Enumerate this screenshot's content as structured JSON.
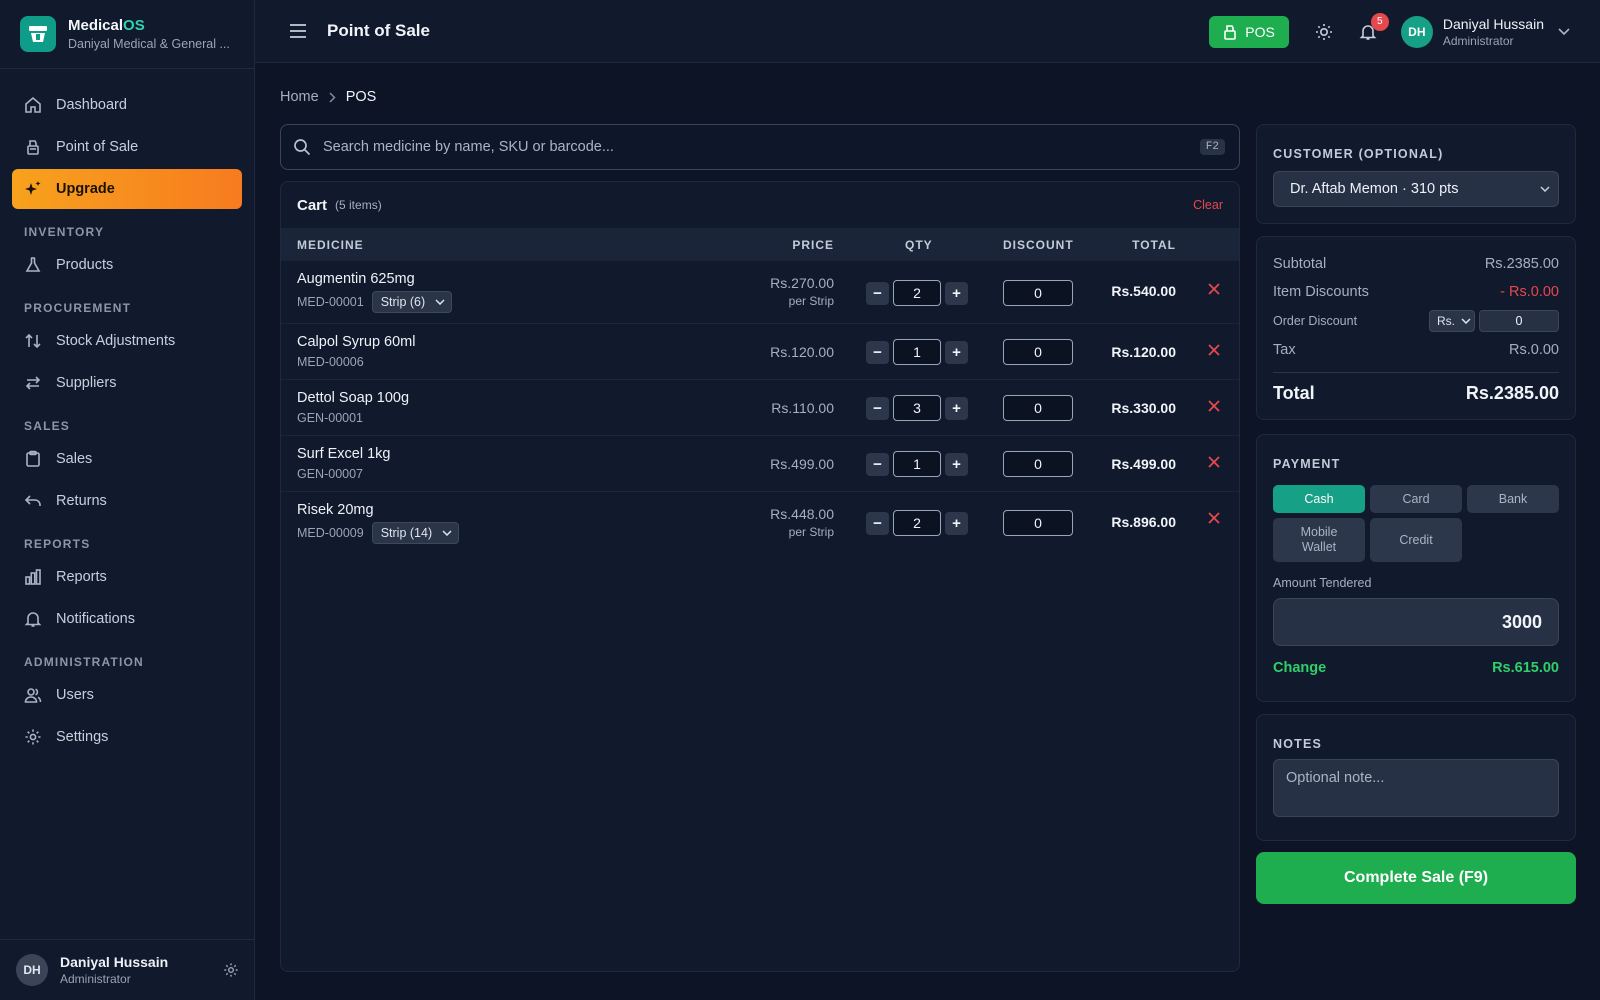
{
  "brand": {
    "name_main": "Medical",
    "name_accent": "OS",
    "subtitle": "Daniyal Medical & General ..."
  },
  "sidebar": {
    "dashboard": "Dashboard",
    "point_of_sale": "Point of Sale",
    "upgrade": "Upgrade",
    "section_inventory": "INVENTORY",
    "products": "Products",
    "section_procurement": "PROCUREMENT",
    "stock_adjustments": "Stock Adjustments",
    "suppliers": "Suppliers",
    "section_sales": "SALES",
    "sales": "Sales",
    "returns": "Returns",
    "section_reports": "REPORTS",
    "reports": "Reports",
    "notifications": "Notifications",
    "section_administration": "ADMINISTRATION",
    "users": "Users",
    "settings": "Settings"
  },
  "sidebar_user": {
    "initials": "DH",
    "name": "Daniyal Hussain",
    "role": "Administrator"
  },
  "topbar": {
    "title": "Point of Sale",
    "pos_label": "POS",
    "notification_count": "5",
    "user_initials": "DH",
    "user_name": "Daniyal Hussain",
    "user_role": "Administrator"
  },
  "breadcrumb": {
    "home": "Home",
    "current": "POS"
  },
  "search": {
    "placeholder": "Search medicine by name, SKU or barcode...",
    "shortcut": "F2"
  },
  "cart": {
    "title": "Cart",
    "count": "(5 items)",
    "clear": "Clear",
    "columns": {
      "medicine": "MEDICINE",
      "price": "PRICE",
      "qty": "QTY",
      "discount": "DISCOUNT",
      "total": "TOTAL"
    },
    "items": [
      {
        "name": "Augmentin 625mg",
        "sku": "MED-00001",
        "unit": "Strip (6)",
        "price": "Rs.270.00",
        "per": "per Strip",
        "qty": "2",
        "discount": "0",
        "total": "Rs.540.00"
      },
      {
        "name": "Calpol Syrup 60ml",
        "sku": "MED-00006",
        "price": "Rs.120.00",
        "qty": "1",
        "discount": "0",
        "total": "Rs.120.00"
      },
      {
        "name": "Dettol Soap 100g",
        "sku": "GEN-00001",
        "price": "Rs.110.00",
        "qty": "3",
        "discount": "0",
        "total": "Rs.330.00"
      },
      {
        "name": "Surf Excel 1kg",
        "sku": "GEN-00007",
        "price": "Rs.499.00",
        "qty": "1",
        "discount": "0",
        "total": "Rs.499.00"
      },
      {
        "name": "Risek 20mg",
        "sku": "MED-00009",
        "unit": "Strip (14)",
        "price": "Rs.448.00",
        "per": "per Strip",
        "qty": "2",
        "discount": "0",
        "total": "Rs.896.00"
      }
    ]
  },
  "customer": {
    "label": "CUSTOMER (OPTIONAL)",
    "selected": "Dr. Aftab Memon · 310 pts"
  },
  "summary": {
    "subtotal_label": "Subtotal",
    "subtotal": "Rs.2385.00",
    "item_discounts_label": "Item Discounts",
    "item_discounts": "- Rs.0.00",
    "order_discount_label": "Order Discount",
    "order_discount_unit": "Rs.",
    "order_discount_value": "0",
    "tax_label": "Tax",
    "tax": "Rs.0.00",
    "total_label": "Total",
    "total": "Rs.2385.00"
  },
  "payment": {
    "label": "PAYMENT",
    "methods": [
      "Cash",
      "Card",
      "Bank",
      "Mobile Wallet",
      "Credit"
    ],
    "selected": "Cash",
    "amount_label": "Amount Tendered",
    "amount": "3000",
    "change_label": "Change",
    "change": "Rs.615.00"
  },
  "notes": {
    "label": "NOTES",
    "placeholder": "Optional note..."
  },
  "complete_button": "Complete Sale (F9)",
  "colors": {
    "accent_green": "#1fae4f",
    "accent_teal": "#16a085",
    "danger": "#e5484d",
    "upgrade_orange": "#f7a21d"
  }
}
